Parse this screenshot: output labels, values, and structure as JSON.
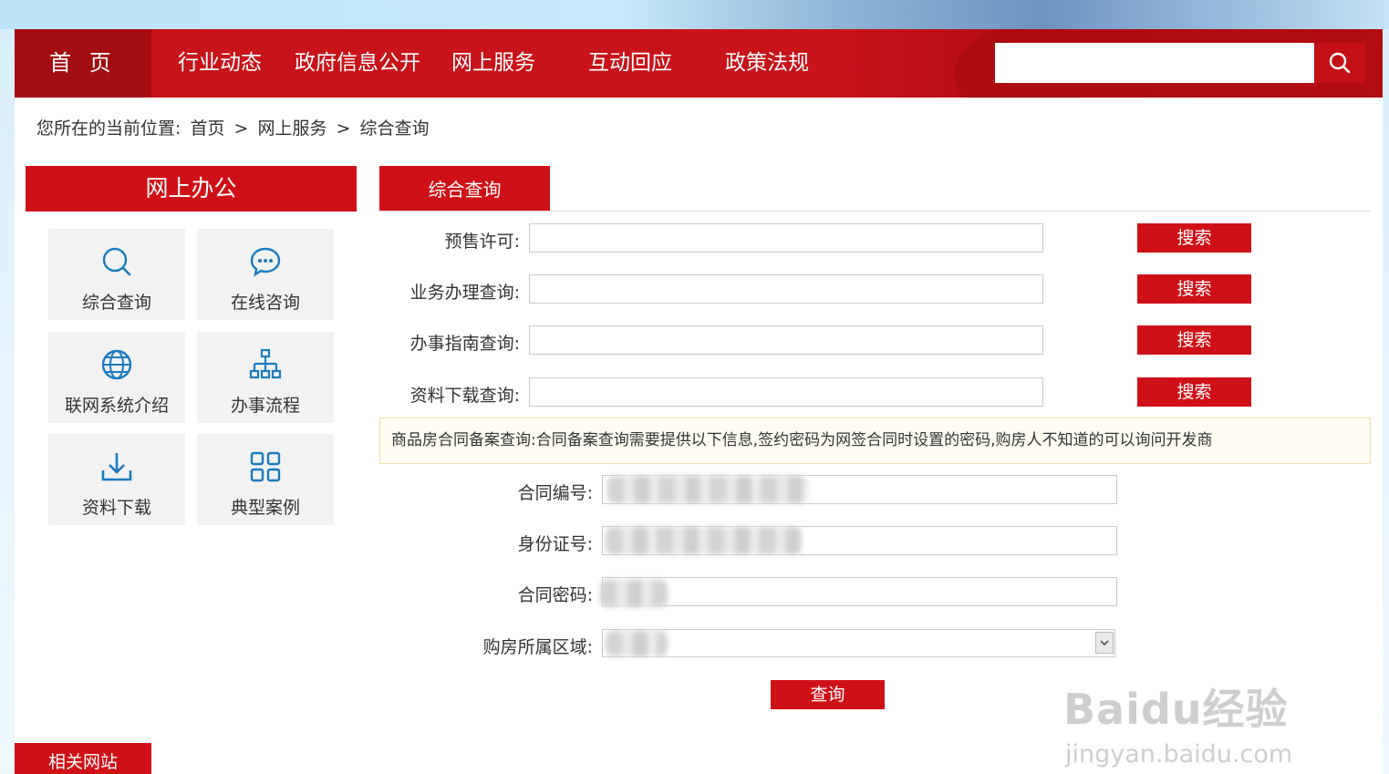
{
  "nav": {
    "home": "首 页",
    "items": [
      "行业动态",
      "政府信息公开",
      "网上服务",
      "互动回应",
      "政策法规"
    ],
    "search_placeholder": ""
  },
  "breadcrumb": {
    "prefix": "您所在的当前位置:",
    "path": [
      "首页",
      ">",
      "网上服务",
      ">",
      "综合查询"
    ]
  },
  "sidebar": {
    "title": "网上办公",
    "tiles": [
      {
        "label": "综合查询",
        "icon": "search-icon"
      },
      {
        "label": "在线咨询",
        "icon": "chat-icon"
      },
      {
        "label": "联网系统介绍",
        "icon": "globe-icon"
      },
      {
        "label": "办事流程",
        "icon": "org-chart-icon"
      },
      {
        "label": "资料下载",
        "icon": "download-icon"
      },
      {
        "label": "典型案例",
        "icon": "grid-icon"
      }
    ],
    "icon_color": "#1a7bbf"
  },
  "main": {
    "tab": "综合查询",
    "search_rows": [
      {
        "label": "预售许可:",
        "button": "搜索"
      },
      {
        "label": "业务办理查询:",
        "button": "搜索"
      },
      {
        "label": "办事指南查询:",
        "button": "搜索"
      },
      {
        "label": "资料下载查询:",
        "button": "搜索"
      }
    ],
    "notice": "商品房合同备案查询:合同备案查询需要提供以下信息,签约密码为网签合同时设置的密码,购房人不知道的可以询问开发商",
    "contract_fields": [
      {
        "label": "合同编号:"
      },
      {
        "label": "身份证号:"
      },
      {
        "label": "合同密码:"
      },
      {
        "label": "购房所属区域:"
      }
    ],
    "query_button": "查询"
  },
  "footer": {
    "related": "相关网站"
  },
  "watermark": {
    "logo": "Baidu经验",
    "sub": "jingyan.baidu.com"
  },
  "colors": {
    "brand_red": "#cf1017",
    "nav_dark": "#a30d12"
  }
}
